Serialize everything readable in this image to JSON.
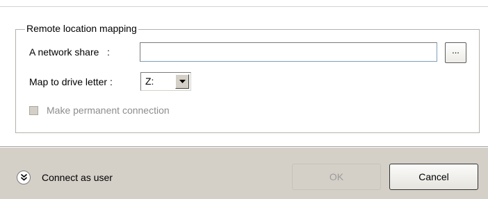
{
  "group": {
    "title": "Remote location mapping"
  },
  "network_share": {
    "label": "A network share   :",
    "value": "",
    "browse_label": "..."
  },
  "drive": {
    "label": "Map to drive letter :",
    "selected": "Z:"
  },
  "permanent": {
    "label": "Make permanent connection",
    "checked": false,
    "enabled": false
  },
  "footer": {
    "connect_label": "Connect as user",
    "ok_label": "OK",
    "cancel_label": "Cancel"
  }
}
